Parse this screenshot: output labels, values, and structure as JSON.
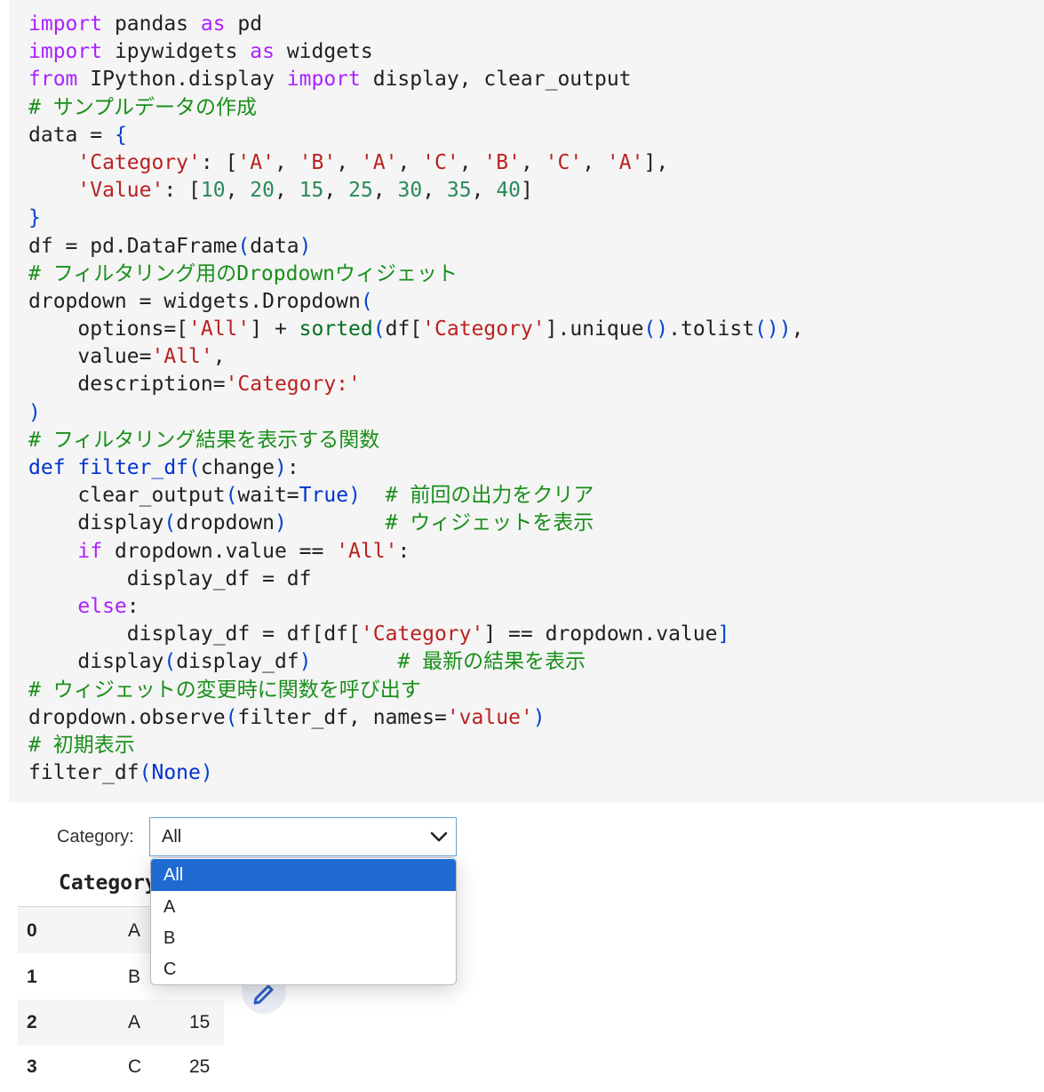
{
  "code_lines": [
    [
      [
        "import",
        "kw"
      ],
      [
        " pandas ",
        ""
      ],
      [
        "as",
        "kw"
      ],
      [
        " pd",
        ""
      ]
    ],
    [
      [
        "import",
        "kw"
      ],
      [
        " ipywidgets ",
        ""
      ],
      [
        "as",
        "kw"
      ],
      [
        " widgets",
        ""
      ]
    ],
    [
      [
        "from",
        "kw"
      ],
      [
        " IPython.display ",
        ""
      ],
      [
        "import",
        "kw"
      ],
      [
        " display, clear_output",
        ""
      ]
    ],
    [
      [
        "# サンプルデータの作成",
        "cm"
      ]
    ],
    [
      [
        "data = ",
        ""
      ],
      [
        "{",
        "pn"
      ]
    ],
    [
      [
        "    ",
        ""
      ],
      [
        "'Category'",
        "st"
      ],
      [
        ": [",
        ""
      ],
      [
        "'A'",
        "st"
      ],
      [
        ", ",
        ""
      ],
      [
        "'B'",
        "st"
      ],
      [
        ", ",
        ""
      ],
      [
        "'A'",
        "st"
      ],
      [
        ", ",
        ""
      ],
      [
        "'C'",
        "st"
      ],
      [
        ", ",
        ""
      ],
      [
        "'B'",
        "st"
      ],
      [
        ", ",
        ""
      ],
      [
        "'C'",
        "st"
      ],
      [
        ", ",
        ""
      ],
      [
        "'A'",
        "st"
      ],
      [
        "],",
        ""
      ]
    ],
    [
      [
        "    ",
        ""
      ],
      [
        "'Value'",
        "st"
      ],
      [
        ": [",
        ""
      ],
      [
        "10",
        "nu"
      ],
      [
        ", ",
        ""
      ],
      [
        "20",
        "nu"
      ],
      [
        ", ",
        ""
      ],
      [
        "15",
        "nu"
      ],
      [
        ", ",
        ""
      ],
      [
        "25",
        "nu"
      ],
      [
        ", ",
        ""
      ],
      [
        "30",
        "nu"
      ],
      [
        ", ",
        ""
      ],
      [
        "35",
        "nu"
      ],
      [
        ", ",
        ""
      ],
      [
        "40",
        "nu"
      ],
      [
        "]",
        ""
      ]
    ],
    [
      [
        "}",
        "pn"
      ]
    ],
    [
      [
        "df = pd.DataFrame",
        ""
      ],
      [
        "(",
        "pn"
      ],
      [
        "data",
        ""
      ],
      [
        ")",
        "pn"
      ]
    ],
    [
      [
        "# フィルタリング用のDropdownウィジェット",
        "cm"
      ]
    ],
    [
      [
        "dropdown = widgets.Dropdown",
        ""
      ],
      [
        "(",
        "pn"
      ]
    ],
    [
      [
        "    options=[",
        ""
      ],
      [
        "'All'",
        "st"
      ],
      [
        "] + ",
        ""
      ],
      [
        "sorted",
        "bi"
      ],
      [
        "(",
        "pn"
      ],
      [
        "df[",
        ""
      ],
      [
        "'Category'",
        "st"
      ],
      [
        "].unique",
        ""
      ],
      [
        "()",
        "pn"
      ],
      [
        ".tolist",
        ""
      ],
      [
        "())",
        "pn"
      ],
      [
        ",",
        ""
      ]
    ],
    [
      [
        "    value=",
        ""
      ],
      [
        "'All'",
        "st"
      ],
      [
        ",",
        ""
      ]
    ],
    [
      [
        "    description=",
        ""
      ],
      [
        "'Category:'",
        "st"
      ]
    ],
    [
      [
        ")",
        "pn"
      ]
    ],
    [
      [
        "# フィルタリング結果を表示する関数",
        "cm"
      ]
    ],
    [
      [
        "def",
        "kw2"
      ],
      [
        " ",
        ""
      ],
      [
        "filter_df",
        "fn"
      ],
      [
        "(",
        "pn"
      ],
      [
        "change",
        ""
      ],
      [
        ")",
        "pn"
      ],
      [
        ":",
        ""
      ]
    ],
    [
      [
        "    clear_output",
        ""
      ],
      [
        "(",
        "pn"
      ],
      [
        "wait=",
        ""
      ],
      [
        "True",
        "kw2"
      ],
      [
        ")",
        "pn"
      ],
      [
        "  ",
        ""
      ],
      [
        "# 前回の出力をクリア",
        "cm"
      ]
    ],
    [
      [
        "    display",
        ""
      ],
      [
        "(",
        "pn"
      ],
      [
        "dropdown",
        ""
      ],
      [
        ")",
        "pn"
      ],
      [
        "        ",
        ""
      ],
      [
        "# ウィジェットを表示",
        "cm"
      ]
    ],
    [
      [
        "    ",
        ""
      ],
      [
        "if",
        "kw"
      ],
      [
        " dropdown.value == ",
        ""
      ],
      [
        "'All'",
        "st"
      ],
      [
        ":",
        ""
      ]
    ],
    [
      [
        "        display_df = df",
        ""
      ]
    ],
    [
      [
        "    ",
        ""
      ],
      [
        "else",
        "kw"
      ],
      [
        ":",
        ""
      ]
    ],
    [
      [
        "        display_df = df[df[",
        ""
      ],
      [
        "'Category'",
        "st"
      ],
      [
        "] == dropdown.value",
        ""
      ],
      [
        "]",
        "pn"
      ]
    ],
    [
      [
        "    display",
        ""
      ],
      [
        "(",
        "pn"
      ],
      [
        "display_df",
        ""
      ],
      [
        ")",
        "pn"
      ],
      [
        "       ",
        ""
      ],
      [
        "# 最新の結果を表示",
        "cm"
      ]
    ],
    [
      [
        "# ウィジェットの変更時に関数を呼び出す",
        "cm"
      ]
    ],
    [
      [
        "dropdown.observe",
        ""
      ],
      [
        "(",
        "pn"
      ],
      [
        "filter_df, names=",
        ""
      ],
      [
        "'value'",
        "st"
      ],
      [
        ")",
        "pn"
      ]
    ],
    [
      [
        "# 初期表示",
        "cm"
      ]
    ],
    [
      [
        "filter_df",
        ""
      ],
      [
        "(",
        "pn"
      ],
      [
        "None",
        "kw2"
      ],
      [
        ")",
        "pn"
      ]
    ]
  ],
  "widget": {
    "label": "Category:",
    "value": "All",
    "options": [
      "All",
      "A",
      "B",
      "C"
    ],
    "selected_index": 0
  },
  "table": {
    "header": "Category",
    "rows": [
      {
        "index": "0",
        "category": "A",
        "value": ""
      },
      {
        "index": "1",
        "category": "B",
        "value": ""
      },
      {
        "index": "2",
        "category": "A",
        "value": "15"
      },
      {
        "index": "3",
        "category": "C",
        "value": "25"
      }
    ]
  }
}
